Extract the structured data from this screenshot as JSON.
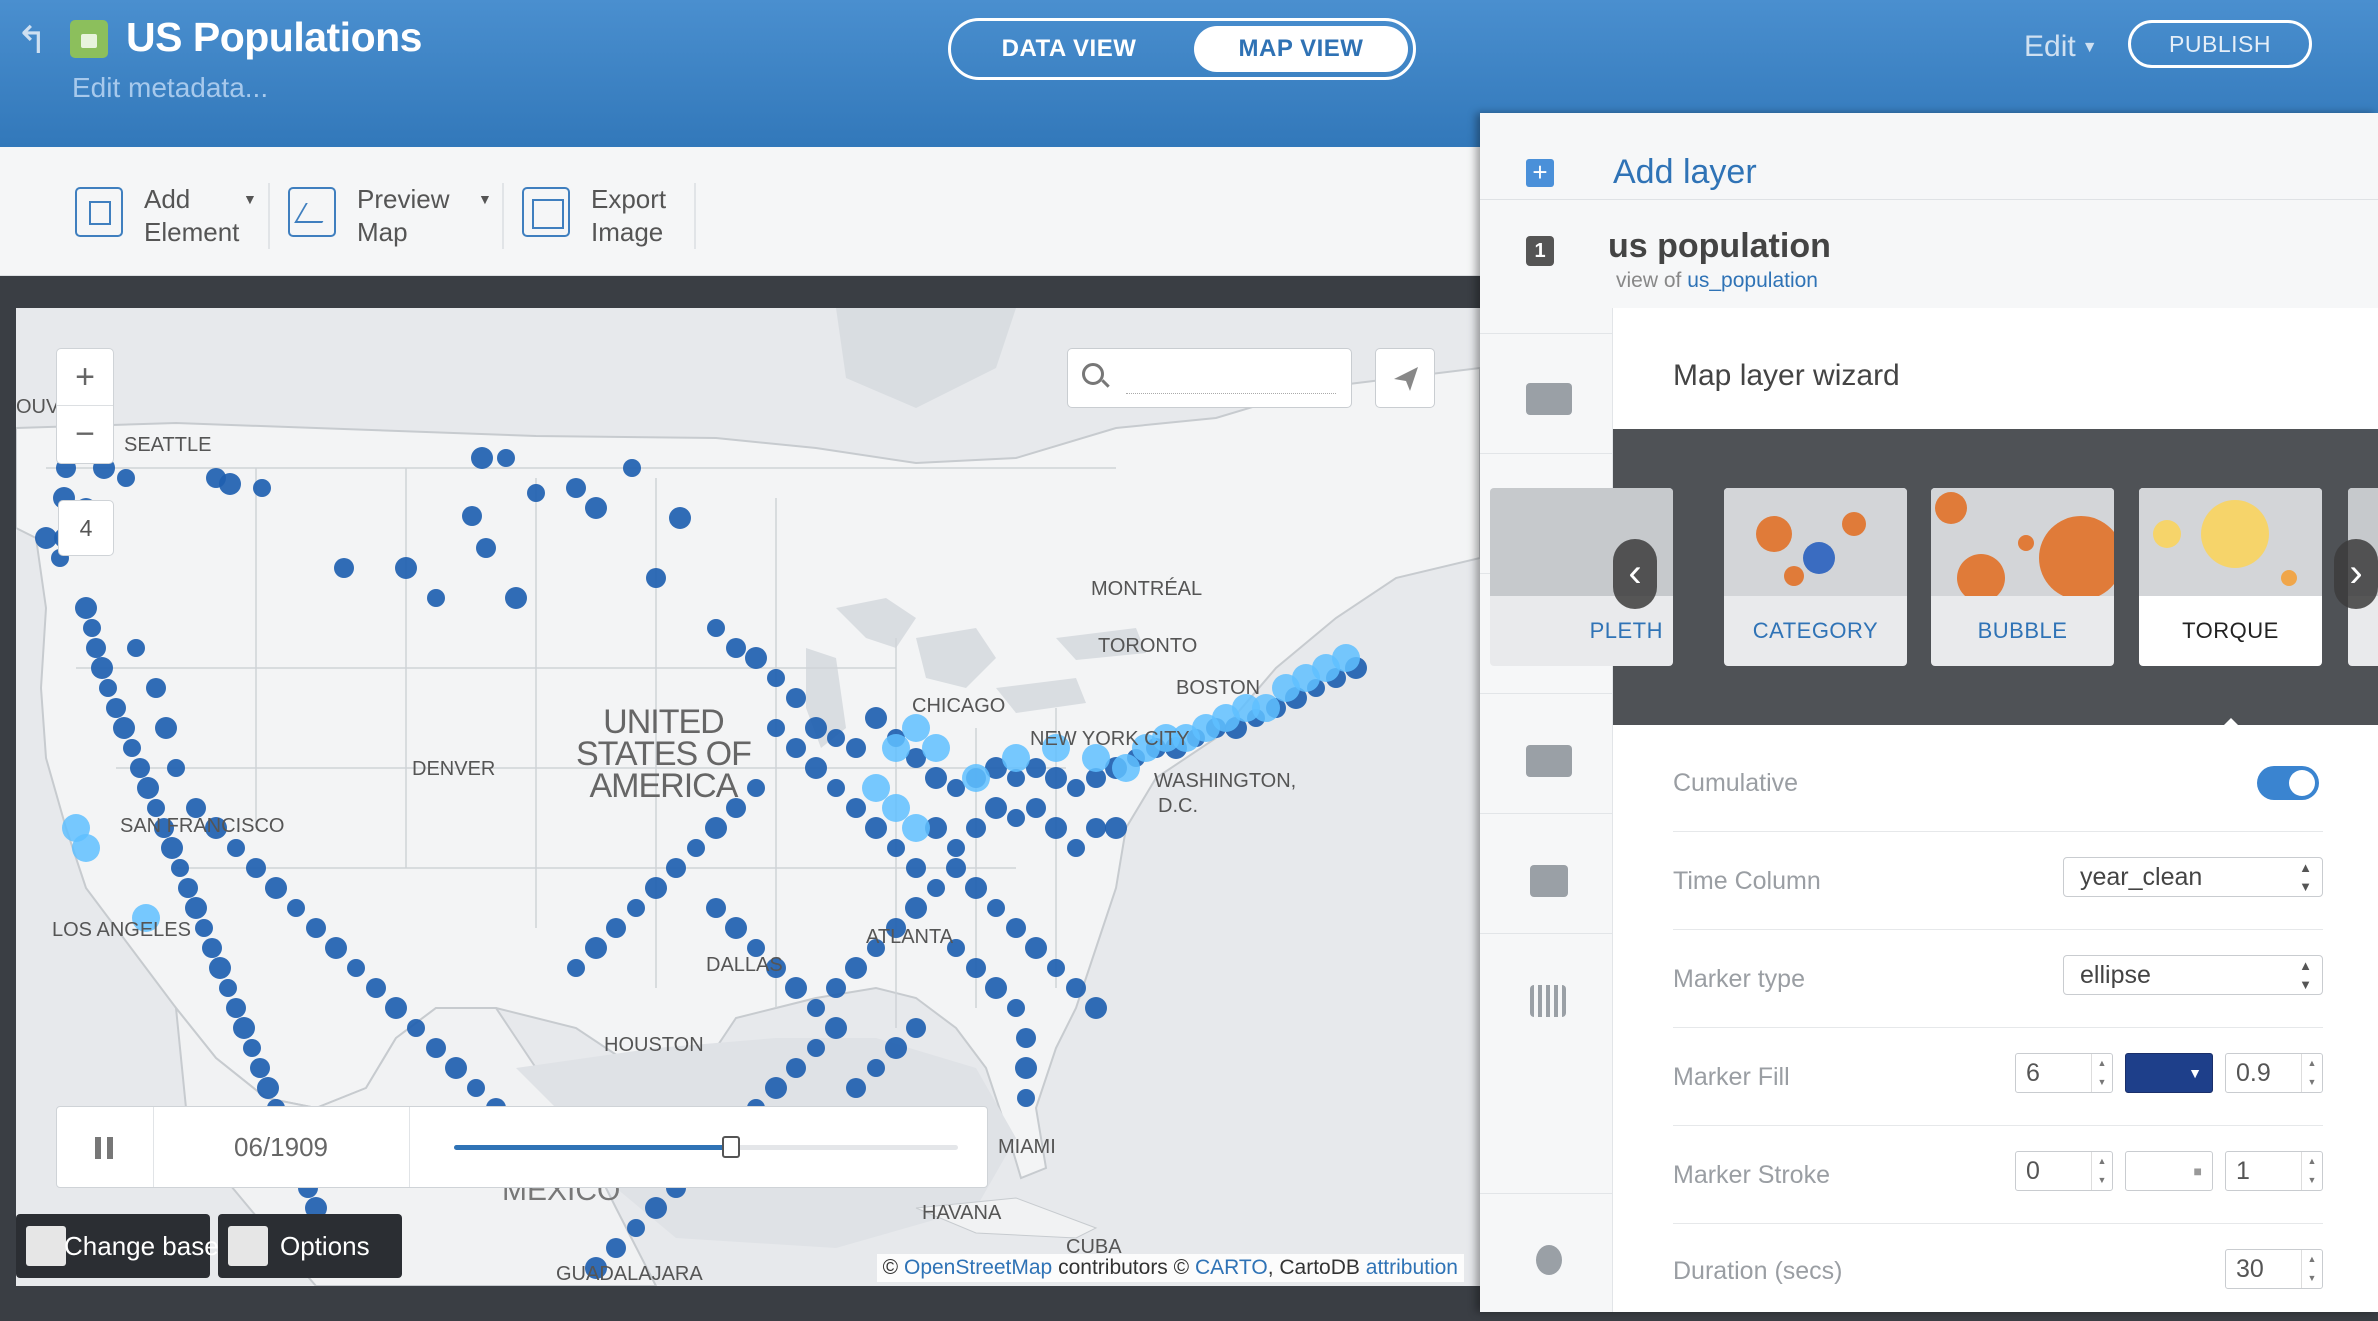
{
  "header": {
    "title": "US Populations",
    "subtitle": "Edit metadata...",
    "data_view": "DATA VIEW",
    "map_view": "MAP VIEW",
    "edit": "Edit",
    "publish": "PUBLISH",
    "accent": "#3a82c4"
  },
  "toolbar": {
    "add_element": "Add\nElement",
    "preview_map": "Preview\nMap",
    "export_image": "Export\nImage"
  },
  "map": {
    "zoom_in": "+",
    "zoom_out": "−",
    "zoom_level": "4",
    "search_placeholder": "",
    "labels": {
      "seattle": "SEATTLE",
      "vancouver": "OUVER",
      "montreal": "MONTRÉAL",
      "toronto": "TORONTO",
      "boston": "BOSTON",
      "chicago": "CHICAGO",
      "nyc": "NEW YORK CITY",
      "washington": "WASHINGTON,",
      "dc": "D.C.",
      "denver": "DENVER",
      "us1": "UNITED",
      "us2": "STATES OF",
      "us3": "AMERICA",
      "sf": "SAN FRANCISCO",
      "la": "LOS ANGELES",
      "dallas": "DALLAS",
      "atlanta": "ATLANTA",
      "houston": "HOUSTON",
      "miami": "MIAMI",
      "mexico": "MEXICO",
      "havana": "HAVANA",
      "cuba": "CUBA",
      "guadalajara": "GUADALAJARA"
    },
    "timeline": {
      "date": "06/1909",
      "progress": 0.55
    },
    "change_basemap": "Change basemap",
    "options": "Options",
    "attribution": {
      "prefix": "©",
      "osm": "OpenStreetMap",
      "mid": "contributors ©",
      "carto": "CARTO",
      "cartodb": ", CartoDB",
      "attr": "attribution"
    },
    "marker_color": "#1f5fb0",
    "glow_color": "#5fc0ff"
  },
  "panel": {
    "add_layer": "Add layer",
    "layer_number": "1",
    "layer_name": "us population",
    "view_of": "view of",
    "source": "us_population",
    "rail_icons": [
      "sql-icon",
      "wizard-icon",
      "infowindow-icon",
      "css-icon",
      "legend-icon",
      "filter-icon",
      "lightbulb-icon"
    ],
    "wizard": {
      "title": "Map layer wizard",
      "cards": [
        "PLETH",
        "CATEGORY",
        "BUBBLE",
        "TORQUE"
      ],
      "selected": "TORQUE",
      "cumulative_label": "Cumulative",
      "cumulative_on": true,
      "time_column_label": "Time Column",
      "time_column_value": "year_clean",
      "marker_type_label": "Marker type",
      "marker_type_value": "ellipse",
      "marker_fill_label": "Marker Fill",
      "marker_fill_width": "6",
      "marker_fill_color": "#1e3f8a",
      "marker_fill_opacity": "0.9",
      "marker_stroke_label": "Marker Stroke",
      "marker_stroke_width": "0",
      "marker_stroke_opacity": "1",
      "duration_label": "Duration (secs)",
      "duration_value": "30"
    }
  }
}
